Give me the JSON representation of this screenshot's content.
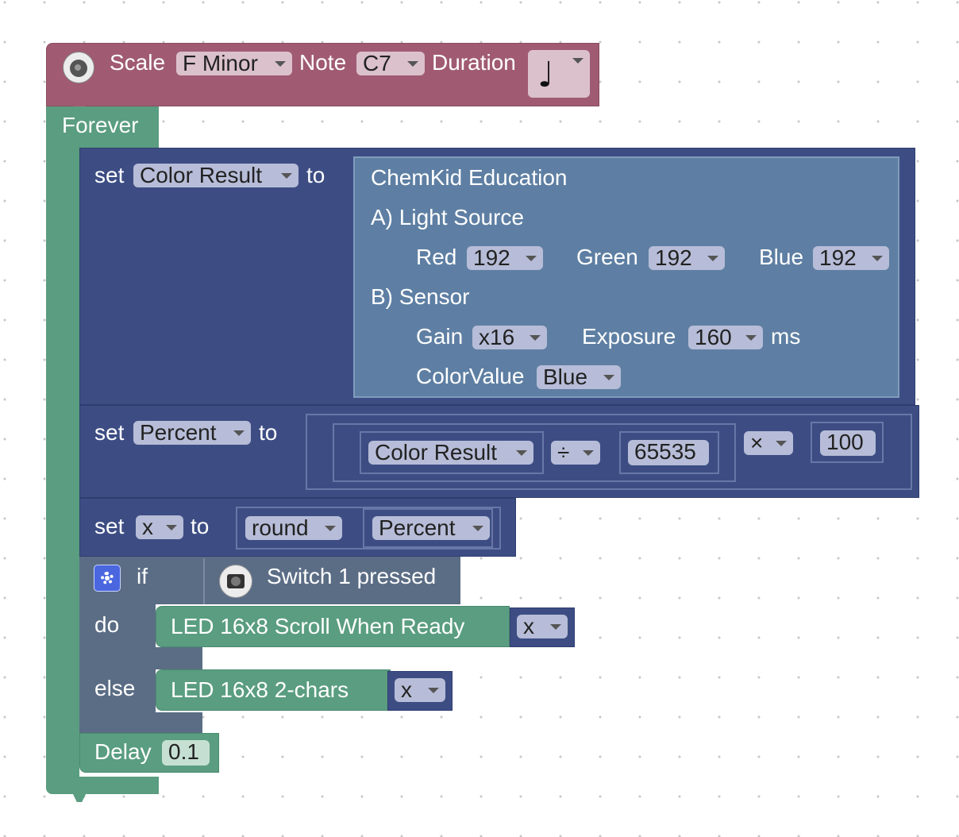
{
  "tone_block": {
    "scale_label": "Scale",
    "scale_value": "F Minor",
    "note_label": "Note",
    "note_value": "C7",
    "duration_label": "Duration",
    "duration_value": "♩",
    "icon": "buzzer-icon"
  },
  "forever_label": "Forever",
  "set_color": {
    "set": "set",
    "variable": "Color Result",
    "to": "to"
  },
  "chemkid": {
    "title": "ChemKid Education",
    "light_source": "A) Light Source",
    "red_label": "Red",
    "red_value": "192",
    "green_label": "Green",
    "green_value": "192",
    "blue_label": "Blue",
    "blue_value": "192",
    "sensor": "B) Sensor",
    "gain_label": "Gain",
    "gain_value": "x16",
    "exposure_label": "Exposure",
    "exposure_value": "160",
    "ms": "ms",
    "colorvalue_label": "ColorValue",
    "colorvalue_value": "Blue"
  },
  "set_percent": {
    "set": "set",
    "variable": "Percent",
    "to": "to",
    "operand_var": "Color Result",
    "divide_op": "÷",
    "divisor": "65535",
    "multiply_op": "×",
    "multiplier": "100"
  },
  "set_x": {
    "set": "set",
    "variable": "x",
    "to": "to",
    "func": "round",
    "arg": "Percent"
  },
  "if_block": {
    "if": "if",
    "do": "do",
    "else": "else",
    "condition": "Switch 1 pressed",
    "gear_icon": "gear-icon",
    "switch_icon": "button-switch-icon"
  },
  "scroll_block": {
    "label": "LED 16x8 Scroll When Ready",
    "var": "x"
  },
  "chars_block": {
    "label": "LED 16x8 2-chars",
    "var": "x"
  },
  "delay_block": {
    "label": "Delay",
    "value": "0.1"
  },
  "colors": {
    "tone": "#a05b73",
    "forever": "#5a9d80",
    "variables": "#3d4d84",
    "chemkid": "#5e7fa3",
    "logic": "#5b6d85"
  }
}
